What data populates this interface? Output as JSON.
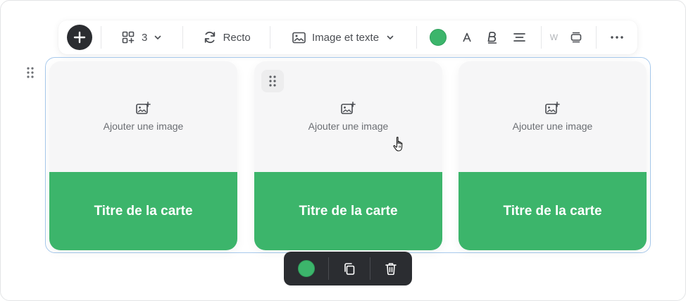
{
  "toolbar": {
    "columns_count": "3",
    "face_label": "Recto",
    "layout_label": "Image et texte",
    "color_value": "#3cb56b",
    "size_letter": "W"
  },
  "cards": [
    {
      "image_label": "Ajouter une image",
      "title": "Titre de la carte"
    },
    {
      "image_label": "Ajouter une image",
      "title": "Titre de la carte"
    },
    {
      "image_label": "Ajouter une image",
      "title": "Titre de la carte"
    }
  ],
  "colors": {
    "accent_green": "#3cb56b",
    "selection_border": "#a7c9ec",
    "dark_toolbar": "#2b2d31"
  },
  "icons": {
    "add": "plus-icon",
    "columns": "grid-icon",
    "face": "refresh-icon",
    "layout": "image-icon",
    "image_placeholder": "add-image-icon",
    "text_color": "text-color-icon",
    "bold": "bold-icon",
    "align": "align-icon",
    "card_style": "card-style-icon",
    "more": "more-icon",
    "duplicate": "copy-icon",
    "delete": "trash-icon"
  }
}
